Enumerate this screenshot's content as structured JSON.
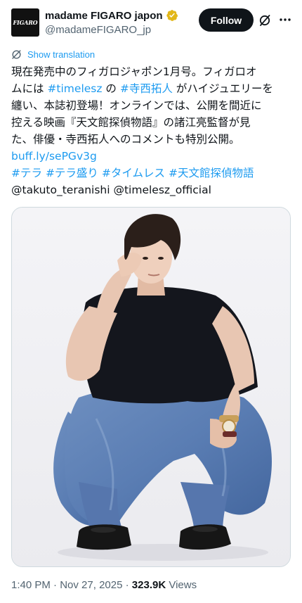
{
  "account": {
    "display_name": "madame FIGARO japon",
    "handle": "@madameFIGARO_jp",
    "avatar_text": "FIGARO",
    "verified_color": "#e2b719"
  },
  "actions": {
    "follow_label": "Follow",
    "grok_icon": "grok-icon",
    "more_icon": "more-icon"
  },
  "translate": {
    "label": "Show translation"
  },
  "tweet": {
    "line1": "現在発売中のフィガロジャポン1月号。フィガロオ",
    "line2_pre": "ムには ",
    "hashtag_timelesz": "#timelesz",
    "line2_mid": " の ",
    "hashtag_teranishi": "#寺西拓人",
    "line2_post": " がハイジュエリーを",
    "line3": "纏い、本誌初登場！オンラインでは、公開を間近に",
    "line4": "控える映画『天文館探偵物語』の諸江亮監督が見",
    "line5": "た、俳優・寺西拓人へのコメントも特別公開。",
    "link": "buff.ly/sePGv3g",
    "hashtags": [
      "#テラ",
      "#テラ盛り",
      "#タイムレス",
      "#天文館探偵物語"
    ],
    "mention_1": "@takuto_teranishi",
    "mention_2": "@timelesz_official"
  },
  "meta": {
    "time": "1:40 PM",
    "date": "Nov 27, 2025",
    "views_count": "323.9K",
    "views_label": "Views",
    "separator": "·"
  }
}
